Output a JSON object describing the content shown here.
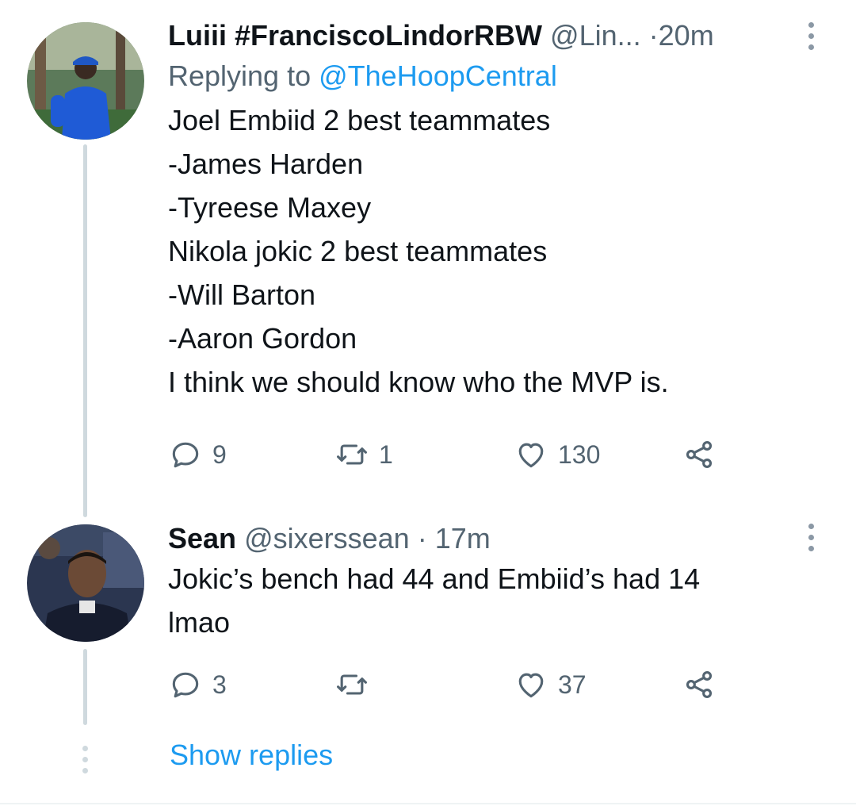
{
  "tweets": [
    {
      "display_name": "Luiii #FranciscoLindorRBW",
      "handle": "@Lin...",
      "separator": "·",
      "time": "20m",
      "replying_prefix": "Replying to",
      "replying_handle": "@TheHoopCentral",
      "lines": [
        "Joel Embiid 2 best teammates",
        "-James Harden",
        "-Tyreese Maxey",
        "Nikola jokic 2 best teammates",
        "-Will Barton",
        "-Aaron Gordon",
        "I think we should know who the MVP is."
      ],
      "replies": "9",
      "retweets": "1",
      "likes": "130",
      "avatar": "player-in-blue-cap-photo"
    },
    {
      "display_name": "Sean",
      "handle": "@sixerssean",
      "separator": "·",
      "time": "17m",
      "lines": [
        "Jokic’s bench had 44 and Embiid’s had 14",
        "lmao"
      ],
      "replies": "3",
      "retweets": "",
      "likes": "37",
      "avatar": "man-in-dark-jacket-photo"
    }
  ],
  "show_replies": "Show replies",
  "icons": {
    "reply": "reply-icon",
    "retweet": "retweet-icon",
    "like": "heart-icon",
    "share": "share-icon",
    "more": "more-vertical-icon"
  },
  "colors": {
    "text": "#0f1419",
    "secondary": "#536471",
    "link": "#1d9bf0",
    "thread_line": "#cfd9de",
    "icon": "#536471"
  }
}
